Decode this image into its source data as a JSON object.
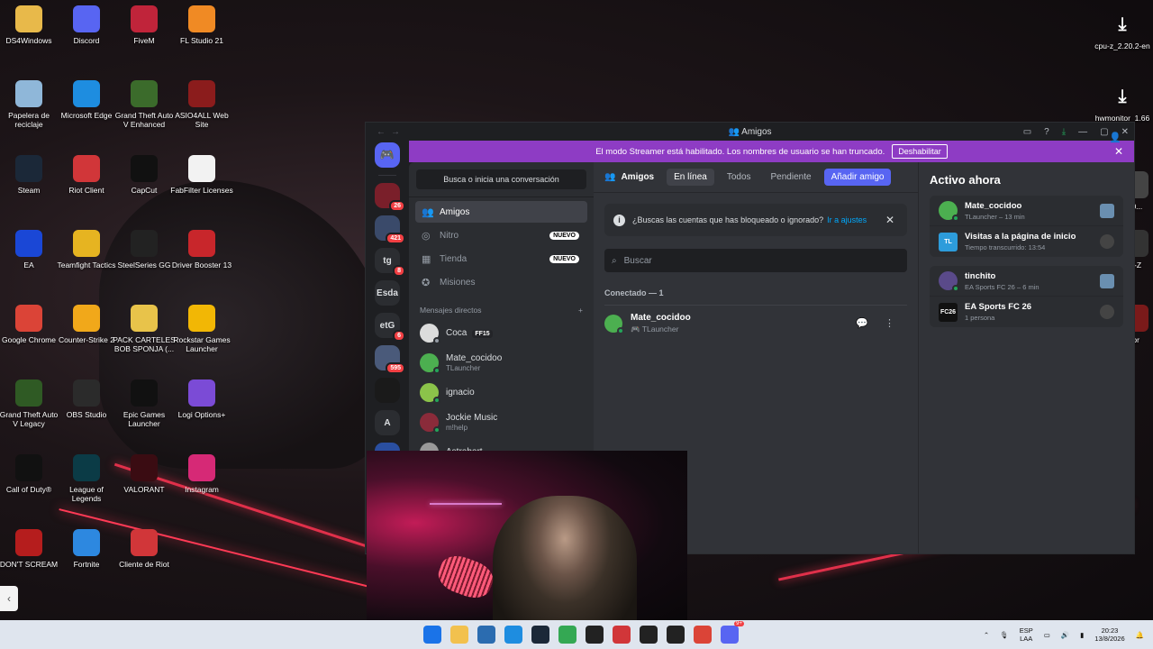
{
  "desktop": {
    "icons": [
      {
        "label": "DS4Windows",
        "icon": "folder-icon",
        "color": "#e8b94a"
      },
      {
        "label": "Discord",
        "icon": "discord-icon",
        "color": "#5865f2"
      },
      {
        "label": "FiveM",
        "icon": "fivem-icon",
        "color": "#c0243a"
      },
      {
        "label": "FL Studio 21",
        "icon": "flstudio-icon",
        "color": "#f08a24"
      },
      {
        "label": "Papelera de reciclaje",
        "icon": "recycle-bin-icon",
        "color": "#8fb7d9"
      },
      {
        "label": "Microsoft Edge",
        "icon": "edge-icon",
        "color": "#1e8de0"
      },
      {
        "label": "Grand Theft Auto V Enhanced",
        "icon": "gta-icon",
        "color": "#3b6b2b"
      },
      {
        "label": "ASIO4ALL Web Site",
        "icon": "asio-icon",
        "color": "#8b1c1c"
      },
      {
        "label": "Steam",
        "icon": "steam-icon",
        "color": "#1b2838"
      },
      {
        "label": "Riot Client",
        "icon": "riot-icon",
        "color": "#d13639"
      },
      {
        "label": "CapCut",
        "icon": "capcut-icon",
        "color": "#111111"
      },
      {
        "label": "FabFilter Licenses",
        "icon": "file-icon",
        "color": "#f2f2f2"
      },
      {
        "label": "EA",
        "icon": "ea-icon",
        "color": "#1a47d6"
      },
      {
        "label": "Teamfight Tactics",
        "icon": "tft-icon",
        "color": "#e6b421"
      },
      {
        "label": "SteelSeries GG",
        "icon": "steelseries-icon",
        "color": "#222222"
      },
      {
        "label": "Driver Booster 13",
        "icon": "driver-booster-icon",
        "color": "#c8262b"
      },
      {
        "label": "Google Chrome",
        "icon": "chrome-icon",
        "color": "#db4437"
      },
      {
        "label": "Counter-Strike 2",
        "icon": "cs2-icon",
        "color": "#f1a81a"
      },
      {
        "label": "PACK CARTELES BOB SPONJA (...",
        "icon": "zip-icon",
        "color": "#e8c34a"
      },
      {
        "label": "Rockstar Games Launcher",
        "icon": "rockstar-icon",
        "color": "#f2b705"
      },
      {
        "label": "Grand Theft Auto V Legacy",
        "icon": "gta-icon",
        "color": "#2f5a24"
      },
      {
        "label": "OBS Studio",
        "icon": "obs-icon",
        "color": "#2b2b2b"
      },
      {
        "label": "Epic Games Launcher",
        "icon": "epic-icon",
        "color": "#111111"
      },
      {
        "label": "Logi Options+",
        "icon": "logi-icon",
        "color": "#7b4bd6"
      },
      {
        "label": "Call of Duty®",
        "icon": "cod-icon",
        "color": "#111111"
      },
      {
        "label": "League of Legends",
        "icon": "lol-icon",
        "color": "#0b3b46"
      },
      {
        "label": "VALORANT",
        "icon": "valorant-icon",
        "color": "#3a0c12"
      },
      {
        "label": "Instagram",
        "icon": "instagram-icon",
        "color": "#d62976"
      },
      {
        "label": "DON'T SCREAM",
        "icon": "dont-scream-icon",
        "color": "#b51d1d"
      },
      {
        "label": "Fortnite",
        "icon": "fortnite-icon",
        "color": "#2d88e0"
      },
      {
        "label": "Cliente de Riot",
        "icon": "riot-icon",
        "color": "#d13639"
      }
    ],
    "right_icons": [
      {
        "label": "cpu-z_2.20.2-en",
        "icon": "download-icon"
      },
      {
        "label": "hwmonitor_1.66",
        "icon": "download-icon"
      }
    ],
    "partial_labels": [
      "10...",
      "U-Z",
      "tor"
    ]
  },
  "discord": {
    "window_title": "Amigos",
    "streamer_banner": {
      "text": "El modo Streamer está habilitado. Los nombres de usuario se han truncado.",
      "button": "Deshabilitar"
    },
    "servers": [
      {
        "label": "",
        "badge": "26",
        "color": "#7a1f2a"
      },
      {
        "label": "",
        "badge": "421",
        "color": "#3a4a6a"
      },
      {
        "label": "tg",
        "badge": "8",
        "color": "#2b2d31"
      },
      {
        "label": "Esda",
        "badge": "",
        "color": "#2b2d31"
      },
      {
        "label": "etG",
        "badge": "6",
        "color": "#2b2d31"
      },
      {
        "label": "",
        "badge": "595",
        "color": "#4a5a7a"
      },
      {
        "label": "",
        "badge": "",
        "color": "#1a1a1a"
      },
      {
        "label": "A",
        "badge": "",
        "color": "#2b2d31"
      },
      {
        "label": "CSGO",
        "badge": "",
        "color": "#2a4fa0"
      },
      {
        "label": "",
        "badge": "",
        "color": "#8a7a50"
      }
    ],
    "search_conversation": "Busca o inicia una conversación",
    "nav": [
      {
        "label": "Amigos",
        "icon": "friends-icon",
        "badge": ""
      },
      {
        "label": "Nitro",
        "icon": "nitro-icon",
        "badge": "NUEVO"
      },
      {
        "label": "Tienda",
        "icon": "shop-icon",
        "badge": "NUEVO"
      },
      {
        "label": "Misiones",
        "icon": "quests-icon",
        "badge": ""
      }
    ],
    "dm_header": "Mensajes directos",
    "dms": [
      {
        "name": "Coca",
        "sub": "",
        "tag": "FF15",
        "status": "offline",
        "color": "#dcdcdc"
      },
      {
        "name": "Mate_cocidoo",
        "sub": "TLauncher",
        "tag": "",
        "status": "online",
        "color": "#4caf50"
      },
      {
        "name": "ignacio",
        "sub": "",
        "tag": "",
        "status": "online",
        "color": "#8bc34a"
      },
      {
        "name": "Jockie Music",
        "sub": "m!help",
        "tag": "",
        "status": "online",
        "color": "#8a2b3a"
      },
      {
        "name": "Astrobort",
        "sub": "",
        "tag": "",
        "status": "online",
        "color": "#999999"
      }
    ],
    "topbar": {
      "title": "Amigos",
      "tabs": [
        "En línea",
        "Todos",
        "Pendiente"
      ],
      "add_friend": "Añadir amigo"
    },
    "hint": {
      "text": "¿Buscas las cuentas que has bloqueado o ignorado?",
      "link": "Ir a ajustes"
    },
    "search_placeholder": "Buscar",
    "connected_header": "Conectado — 1",
    "friends": [
      {
        "name": "Mate_cocidoo",
        "sub": "TLauncher"
      }
    ],
    "active_now": {
      "title": "Activo ahora",
      "cards": [
        {
          "rows": [
            {
              "title": "Mate_cocidoo",
              "sub": "TLauncher – 13 min",
              "kind": "avatar",
              "color": "#4caf50"
            },
            {
              "title": "Visitas a la página de inicio",
              "sub": "Tiempo transcurrido: 13:54",
              "kind": "square",
              "sq_label": "TL",
              "color": "#2d9cdb"
            }
          ]
        },
        {
          "rows": [
            {
              "title": "tinchito",
              "sub": "EA Sports FC 26 – 6 min",
              "kind": "avatar",
              "color": "#5a4a8a"
            },
            {
              "title": "EA Sports FC 26",
              "sub": "1 persona",
              "kind": "square",
              "sq_label": "FC26",
              "color": "#111111"
            }
          ]
        }
      ]
    }
  },
  "taskbar": {
    "lang": "ESP",
    "lang2": "LAA",
    "time": "20:23",
    "date": "13/8/2026",
    "discord_badge": "9+"
  }
}
